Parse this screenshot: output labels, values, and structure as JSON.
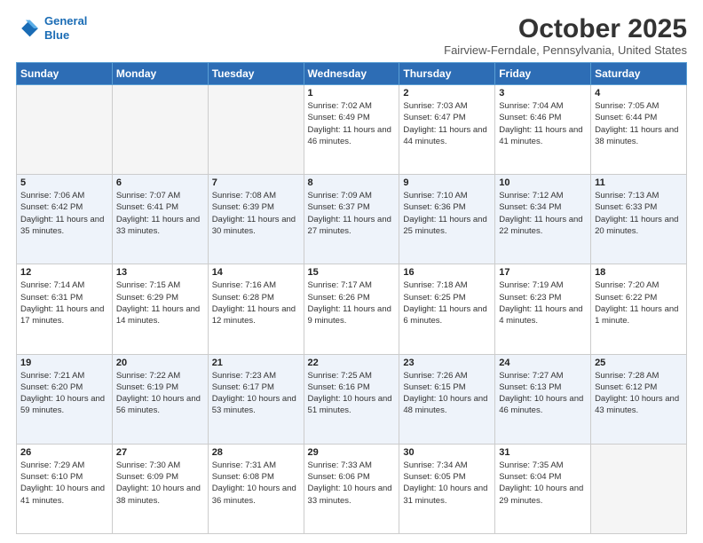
{
  "header": {
    "logo_line1": "General",
    "logo_line2": "Blue",
    "month_title": "October 2025",
    "location": "Fairview-Ferndale, Pennsylvania, United States"
  },
  "days_of_week": [
    "Sunday",
    "Monday",
    "Tuesday",
    "Wednesday",
    "Thursday",
    "Friday",
    "Saturday"
  ],
  "weeks": [
    [
      {
        "day": "",
        "info": ""
      },
      {
        "day": "",
        "info": ""
      },
      {
        "day": "",
        "info": ""
      },
      {
        "day": "1",
        "info": "Sunrise: 7:02 AM\nSunset: 6:49 PM\nDaylight: 11 hours and 46 minutes."
      },
      {
        "day": "2",
        "info": "Sunrise: 7:03 AM\nSunset: 6:47 PM\nDaylight: 11 hours and 44 minutes."
      },
      {
        "day": "3",
        "info": "Sunrise: 7:04 AM\nSunset: 6:46 PM\nDaylight: 11 hours and 41 minutes."
      },
      {
        "day": "4",
        "info": "Sunrise: 7:05 AM\nSunset: 6:44 PM\nDaylight: 11 hours and 38 minutes."
      }
    ],
    [
      {
        "day": "5",
        "info": "Sunrise: 7:06 AM\nSunset: 6:42 PM\nDaylight: 11 hours and 35 minutes."
      },
      {
        "day": "6",
        "info": "Sunrise: 7:07 AM\nSunset: 6:41 PM\nDaylight: 11 hours and 33 minutes."
      },
      {
        "day": "7",
        "info": "Sunrise: 7:08 AM\nSunset: 6:39 PM\nDaylight: 11 hours and 30 minutes."
      },
      {
        "day": "8",
        "info": "Sunrise: 7:09 AM\nSunset: 6:37 PM\nDaylight: 11 hours and 27 minutes."
      },
      {
        "day": "9",
        "info": "Sunrise: 7:10 AM\nSunset: 6:36 PM\nDaylight: 11 hours and 25 minutes."
      },
      {
        "day": "10",
        "info": "Sunrise: 7:12 AM\nSunset: 6:34 PM\nDaylight: 11 hours and 22 minutes."
      },
      {
        "day": "11",
        "info": "Sunrise: 7:13 AM\nSunset: 6:33 PM\nDaylight: 11 hours and 20 minutes."
      }
    ],
    [
      {
        "day": "12",
        "info": "Sunrise: 7:14 AM\nSunset: 6:31 PM\nDaylight: 11 hours and 17 minutes."
      },
      {
        "day": "13",
        "info": "Sunrise: 7:15 AM\nSunset: 6:29 PM\nDaylight: 11 hours and 14 minutes."
      },
      {
        "day": "14",
        "info": "Sunrise: 7:16 AM\nSunset: 6:28 PM\nDaylight: 11 hours and 12 minutes."
      },
      {
        "day": "15",
        "info": "Sunrise: 7:17 AM\nSunset: 6:26 PM\nDaylight: 11 hours and 9 minutes."
      },
      {
        "day": "16",
        "info": "Sunrise: 7:18 AM\nSunset: 6:25 PM\nDaylight: 11 hours and 6 minutes."
      },
      {
        "day": "17",
        "info": "Sunrise: 7:19 AM\nSunset: 6:23 PM\nDaylight: 11 hours and 4 minutes."
      },
      {
        "day": "18",
        "info": "Sunrise: 7:20 AM\nSunset: 6:22 PM\nDaylight: 11 hours and 1 minute."
      }
    ],
    [
      {
        "day": "19",
        "info": "Sunrise: 7:21 AM\nSunset: 6:20 PM\nDaylight: 10 hours and 59 minutes."
      },
      {
        "day": "20",
        "info": "Sunrise: 7:22 AM\nSunset: 6:19 PM\nDaylight: 10 hours and 56 minutes."
      },
      {
        "day": "21",
        "info": "Sunrise: 7:23 AM\nSunset: 6:17 PM\nDaylight: 10 hours and 53 minutes."
      },
      {
        "day": "22",
        "info": "Sunrise: 7:25 AM\nSunset: 6:16 PM\nDaylight: 10 hours and 51 minutes."
      },
      {
        "day": "23",
        "info": "Sunrise: 7:26 AM\nSunset: 6:15 PM\nDaylight: 10 hours and 48 minutes."
      },
      {
        "day": "24",
        "info": "Sunrise: 7:27 AM\nSunset: 6:13 PM\nDaylight: 10 hours and 46 minutes."
      },
      {
        "day": "25",
        "info": "Sunrise: 7:28 AM\nSunset: 6:12 PM\nDaylight: 10 hours and 43 minutes."
      }
    ],
    [
      {
        "day": "26",
        "info": "Sunrise: 7:29 AM\nSunset: 6:10 PM\nDaylight: 10 hours and 41 minutes."
      },
      {
        "day": "27",
        "info": "Sunrise: 7:30 AM\nSunset: 6:09 PM\nDaylight: 10 hours and 38 minutes."
      },
      {
        "day": "28",
        "info": "Sunrise: 7:31 AM\nSunset: 6:08 PM\nDaylight: 10 hours and 36 minutes."
      },
      {
        "day": "29",
        "info": "Sunrise: 7:33 AM\nSunset: 6:06 PM\nDaylight: 10 hours and 33 minutes."
      },
      {
        "day": "30",
        "info": "Sunrise: 7:34 AM\nSunset: 6:05 PM\nDaylight: 10 hours and 31 minutes."
      },
      {
        "day": "31",
        "info": "Sunrise: 7:35 AM\nSunset: 6:04 PM\nDaylight: 10 hours and 29 minutes."
      },
      {
        "day": "",
        "info": ""
      }
    ]
  ]
}
